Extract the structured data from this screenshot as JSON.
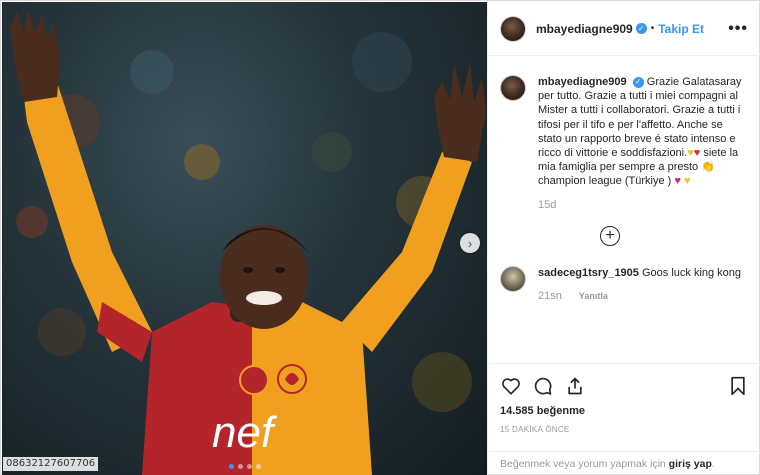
{
  "photo": {
    "image_id": "08632127607706",
    "jersey_sponsor": "nef",
    "carousel_dots": 4,
    "active_dot": 0,
    "colors": {
      "jersey_yellow": "#f0a01e",
      "jersey_red": "#b3242b"
    }
  },
  "post": {
    "username": "mbayediagne909",
    "follow_label": "Takip Et",
    "more_label": "•••",
    "bullet": "•"
  },
  "caption": {
    "username": "mbayediagne909",
    "text_1": "Grazie Galatasaray per tutto. Grazie a tutti i miei compagni al Mister a tutti i collaboratori. Grazie a tutti i tifosi per il tifo e per l'affetto. Anche se stato un rapporto breve é stato intenso e ricco di vittorie e soddisfazioni.",
    "text_2": "siete la mia famiglia per sempre a presto",
    "text_3": "champion league (Türkiye )",
    "age": "15d"
  },
  "comment": {
    "username": "sadeceg1tsry_1905",
    "text": "Goos luck king kong",
    "age": "21sn",
    "reply_label": "Yanıtla"
  },
  "footer": {
    "likes": "14.585 beğenme",
    "time_ago": "15 DAKİKA ÖNCE",
    "login_prefix": "Beğenmek veya yorum yapmak için",
    "login_link": "giriş yap",
    "login_suffix": "."
  },
  "icons": [
    "heart-icon",
    "comment-icon",
    "share-icon",
    "bookmark-icon",
    "plus-circle-icon",
    "chevron-right-icon",
    "verified-icon"
  ]
}
